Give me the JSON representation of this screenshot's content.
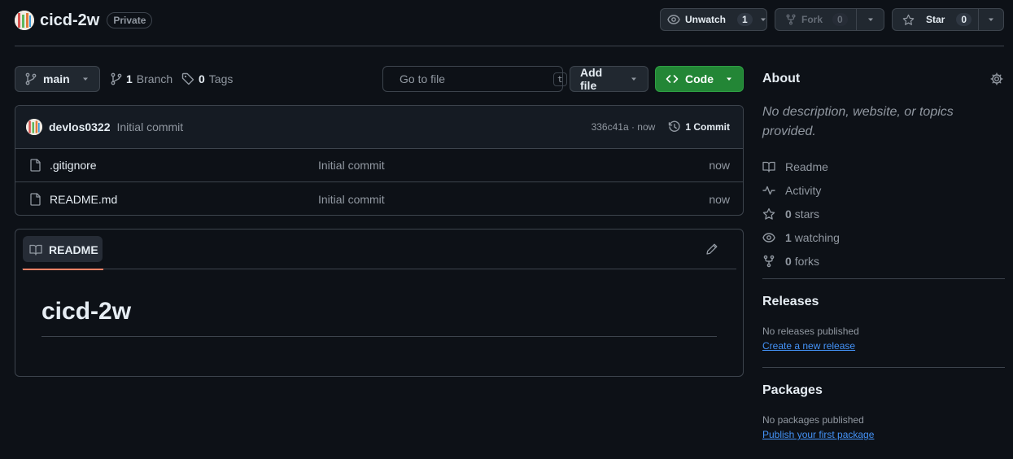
{
  "repo": {
    "name": "cicd-2w",
    "visibility": "Private"
  },
  "header_actions": {
    "watch_label": "Unwatch",
    "watch_count": "1",
    "fork_label": "Fork",
    "fork_count": "0",
    "star_label": "Star",
    "star_count": "0"
  },
  "toolbar": {
    "branch": "main",
    "branch_count": "1",
    "branch_label": "Branch",
    "tag_count": "0",
    "tag_label": "Tags",
    "search_placeholder": "Go to file",
    "search_kbd": "t",
    "add_file_label": "Add file",
    "code_label": "Code"
  },
  "commit": {
    "author": "devlos0322",
    "message": "Initial commit",
    "sha_time": "336c41a · now",
    "count_label": "1 Commit"
  },
  "files": [
    {
      "name": ".gitignore",
      "message": "Initial commit",
      "date": "now"
    },
    {
      "name": "README.md",
      "message": "Initial commit",
      "date": "now"
    }
  ],
  "readme": {
    "tab_label": "README",
    "heading": "cicd-2w"
  },
  "about": {
    "title": "About",
    "description": "No description, website, or topics provided.",
    "items": [
      {
        "icon": "book-icon",
        "count": "",
        "label": "Readme"
      },
      {
        "icon": "pulse-icon",
        "count": "",
        "label": "Activity"
      },
      {
        "icon": "star-icon",
        "count": "0",
        "label": "stars"
      },
      {
        "icon": "eye-icon",
        "count": "1",
        "label": "watching"
      },
      {
        "icon": "fork-icon",
        "count": "0",
        "label": "forks"
      }
    ]
  },
  "releases": {
    "title": "Releases",
    "text": "No releases published",
    "link": "Create a new release"
  },
  "packages": {
    "title": "Packages",
    "text": "No packages published",
    "link": "Publish your first package"
  },
  "colors": {
    "background": "#0d1117",
    "border": "#3d444d",
    "accent_green": "#238636",
    "link_blue": "#4493f8",
    "tab_underline": "#f78166"
  }
}
